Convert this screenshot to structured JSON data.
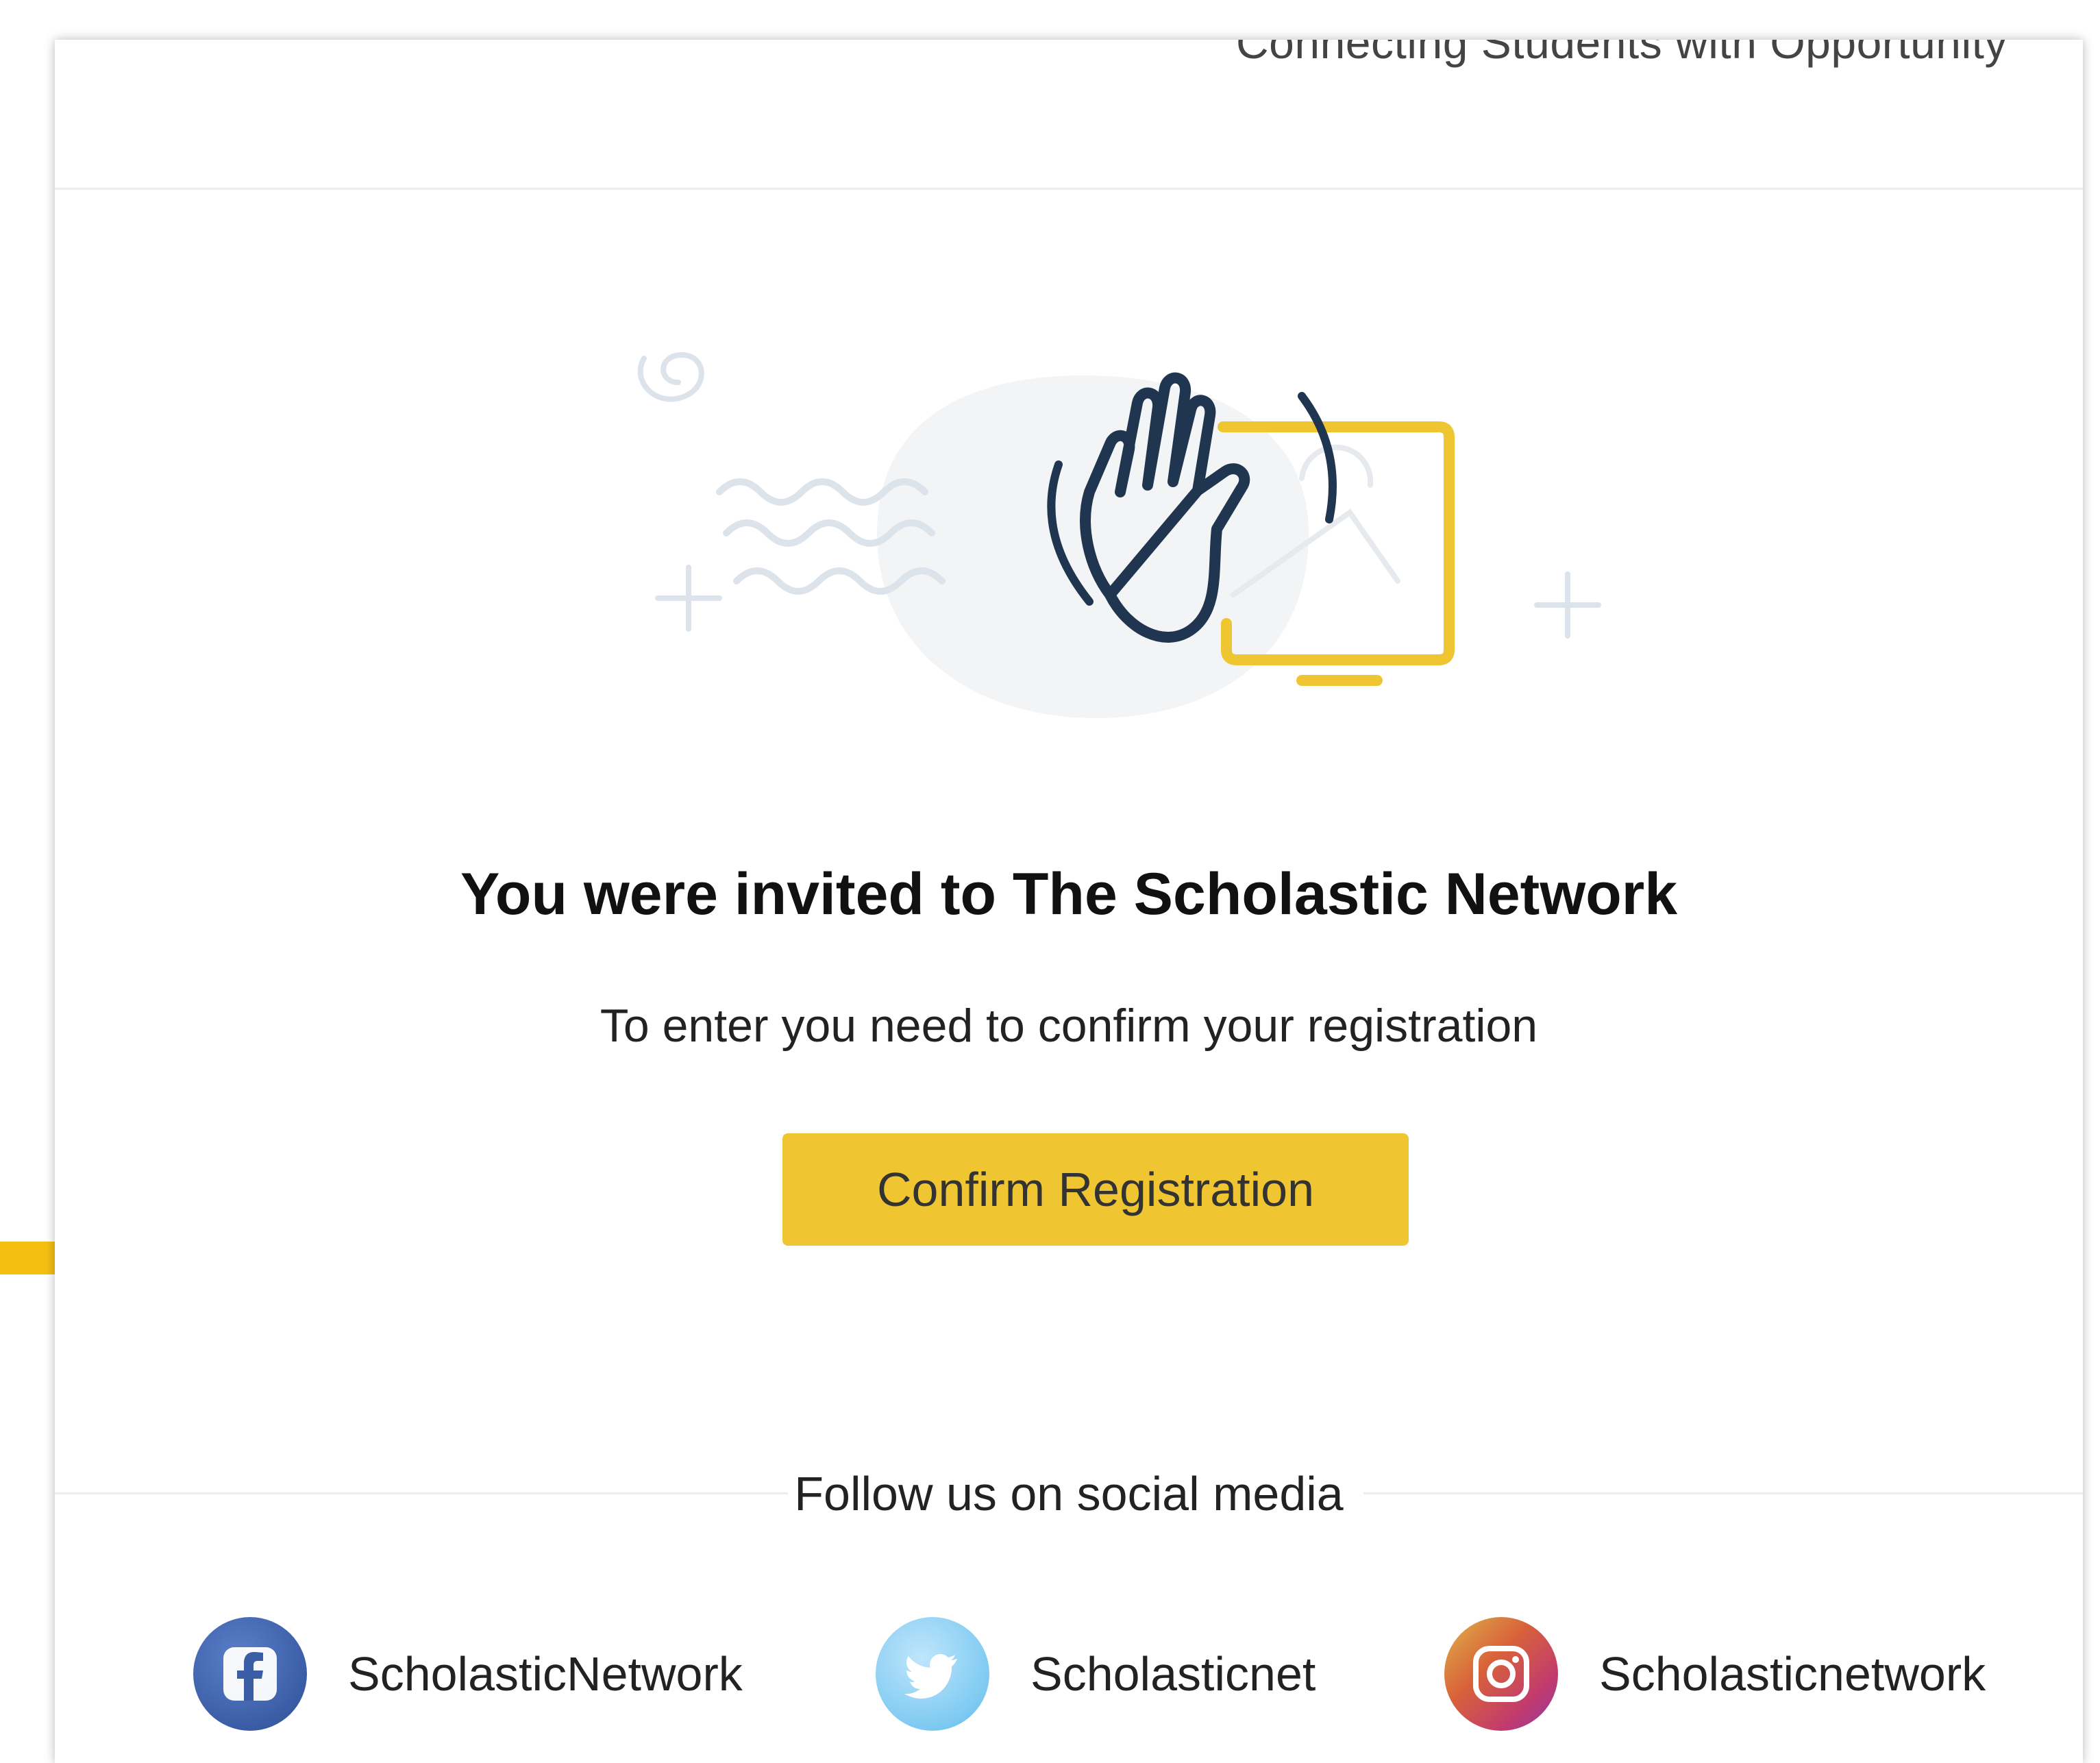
{
  "header": {
    "tagline": "Connecting Students with Opportunity"
  },
  "illustration": {
    "icon": "waving-hand-monitor-icon",
    "colors": {
      "hand_stroke": "#1f3550",
      "monitor_stroke": "#f0c532",
      "decor": "#dde3ea"
    }
  },
  "main": {
    "headline": "You were invited to The Scholastic Network",
    "subtext": "To enter you need to confirm your registration",
    "confirm_button_label": "Confirm Registration"
  },
  "social": {
    "heading": "Follow us on social media",
    "items": [
      {
        "icon": "facebook-icon",
        "label": "ScholasticNetwork"
      },
      {
        "icon": "twitter-icon",
        "label": "Scholasticnet"
      },
      {
        "icon": "instagram-icon",
        "label": "Scholasticnetwork"
      }
    ]
  },
  "colors": {
    "accent": "#f0c532",
    "text": "#222222",
    "divider": "#ececec"
  }
}
